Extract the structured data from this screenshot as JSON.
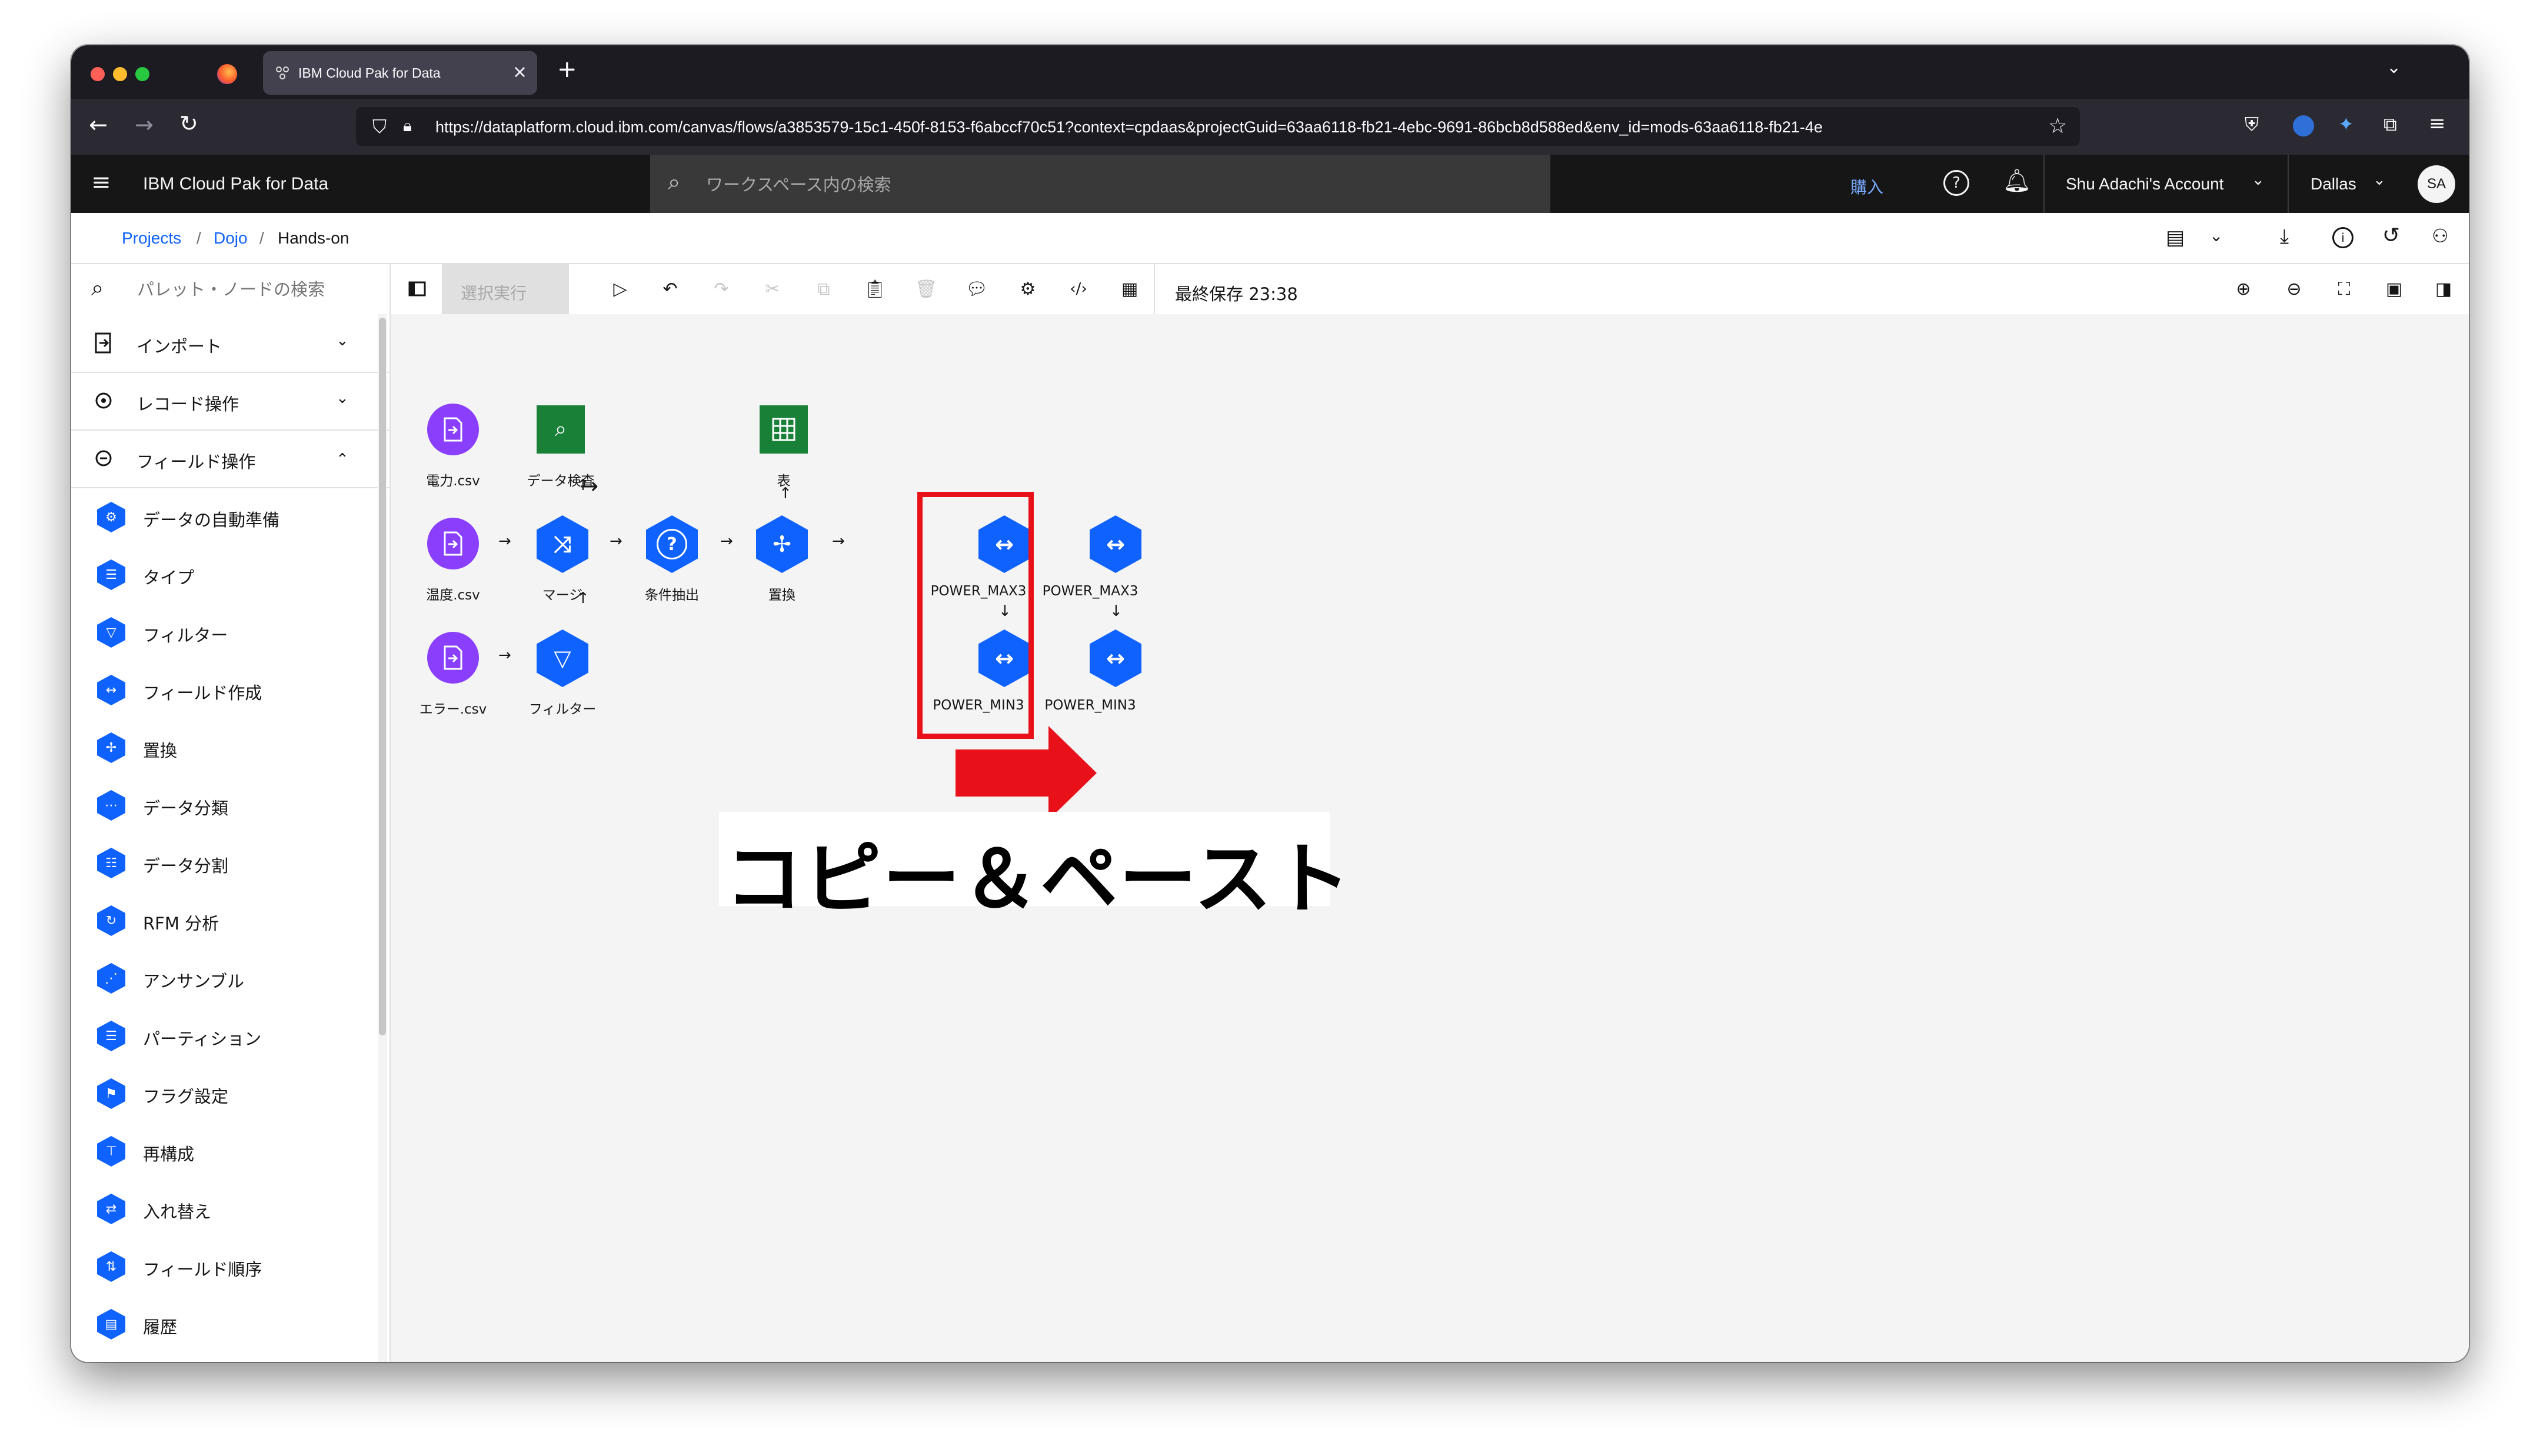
{
  "browser": {
    "tab_title": "IBM Cloud Pak for Data",
    "url": "https://dataplatform.cloud.ibm.com/canvas/flows/a3853579-15c1-450f-8153-f6abccf70c51?context=cpdaas&projectGuid=63aa6118-fb21-4ebc-9691-86bcb8d588ed&env_id=mods-63aa6118-fb21-4e"
  },
  "header": {
    "brand": "IBM Cloud Pak for Data",
    "search_placeholder": "ワークスペース内の検索",
    "purchase": "購入",
    "account": "Shu Adachi's Account",
    "region": "Dallas",
    "avatar": "SA"
  },
  "breadcrumb": {
    "items": [
      "Projects",
      "Dojo",
      "Hands-on"
    ],
    "separator": "/"
  },
  "toolbar": {
    "palette_search_placeholder": "パレット・ノードの検索",
    "run_selected": "選択実行",
    "last_saved": "最終保存 23:38"
  },
  "sidebar": {
    "categories": [
      {
        "label": "インポート",
        "expanded": false
      },
      {
        "label": "レコード操作",
        "expanded": false
      },
      {
        "label": "フィールド操作",
        "expanded": true
      }
    ],
    "items": [
      "データの自動準備",
      "タイプ",
      "フィルター",
      "フィールド作成",
      "置換",
      "データ分類",
      "データ分割",
      "RFM 分析",
      "アンサンブル",
      "パーティション",
      "フラグ設定",
      "再構成",
      "入れ替え",
      "フィールド順序",
      "履歴"
    ]
  },
  "canvas": {
    "nodes": {
      "denryoku": "電力.csv",
      "data_kensa": "データ検査",
      "hyo": "表",
      "ondo": "温度.csv",
      "merge": "マージ",
      "joken": "条件抽出",
      "chikan": "置換",
      "power_max": "POWER_MAX3",
      "power_max_copy": "POWER_MAX3",
      "error": "エラー.csv",
      "filter": "フィルター",
      "power_min": "POWER_MIN3",
      "power_min_copy": "POWER_MIN3"
    },
    "annotation": "コピー＆ペースト",
    "colors": {
      "highlight": "#e8111a",
      "source_node": "#8a3ffc",
      "process_node": "#0f62fe",
      "output_node": "#198038"
    }
  }
}
